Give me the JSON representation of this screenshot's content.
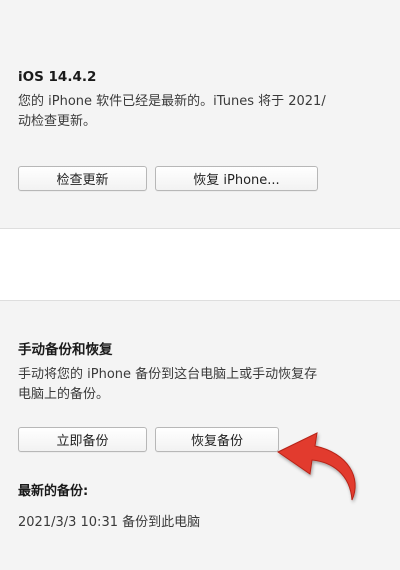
{
  "software_section": {
    "version_title": "iOS 14.4.2",
    "description_line1": "您的 iPhone 软件已经是最新的。iTunes 将于 2021/",
    "description_line2": "动检查更新。",
    "check_update_button": "检查更新",
    "restore_iphone_button": "恢复 iPhone..."
  },
  "backup_section": {
    "title": "手动备份和恢复",
    "description_line1": "手动将您的 iPhone 备份到这台电脑上或手动恢复存",
    "description_line2": "电脑上的备份。",
    "backup_now_button": "立即备份",
    "restore_backup_button": "恢复备份",
    "latest_backup_label": "最新的备份:",
    "latest_backup_value": "2021/3/3 10:31 备份到此电脑"
  },
  "annotation": {
    "arrow_color": "#e23b2e"
  }
}
